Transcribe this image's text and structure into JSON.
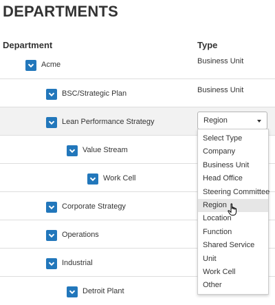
{
  "page": {
    "title": "DEPARTMENTS"
  },
  "table": {
    "headers": {
      "department": "Department",
      "type": "Type"
    },
    "rows": [
      {
        "name": "Acme",
        "type": "Business Unit"
      },
      {
        "name": "BSC/Strategic Plan",
        "type": "Business Unit"
      },
      {
        "name": "Lean Performance Strategy",
        "type": "Region"
      },
      {
        "name": "Value Stream",
        "type": ""
      },
      {
        "name": "Work Cell",
        "type": ""
      },
      {
        "name": "Corporate Strategy",
        "type": ""
      },
      {
        "name": "Operations",
        "type": ""
      },
      {
        "name": "Industrial",
        "type": ""
      },
      {
        "name": "Detroit Plant",
        "type": ""
      }
    ]
  },
  "dropdown": {
    "selected": "Region",
    "hovered": "Region",
    "options": [
      "Select Type",
      "Company",
      "Business Unit",
      "Head Office",
      "Steering Committee",
      "Region",
      "Location",
      "Function",
      "Shared Service",
      "Unit",
      "Work Cell",
      "Other"
    ]
  },
  "colors": {
    "accent": "#2277bb",
    "row_shade": "#f2f2f2",
    "hover": "#e6e6e6"
  },
  "icons": {
    "expand": "chevron-down-icon",
    "pointer": "hand-cursor-icon"
  }
}
